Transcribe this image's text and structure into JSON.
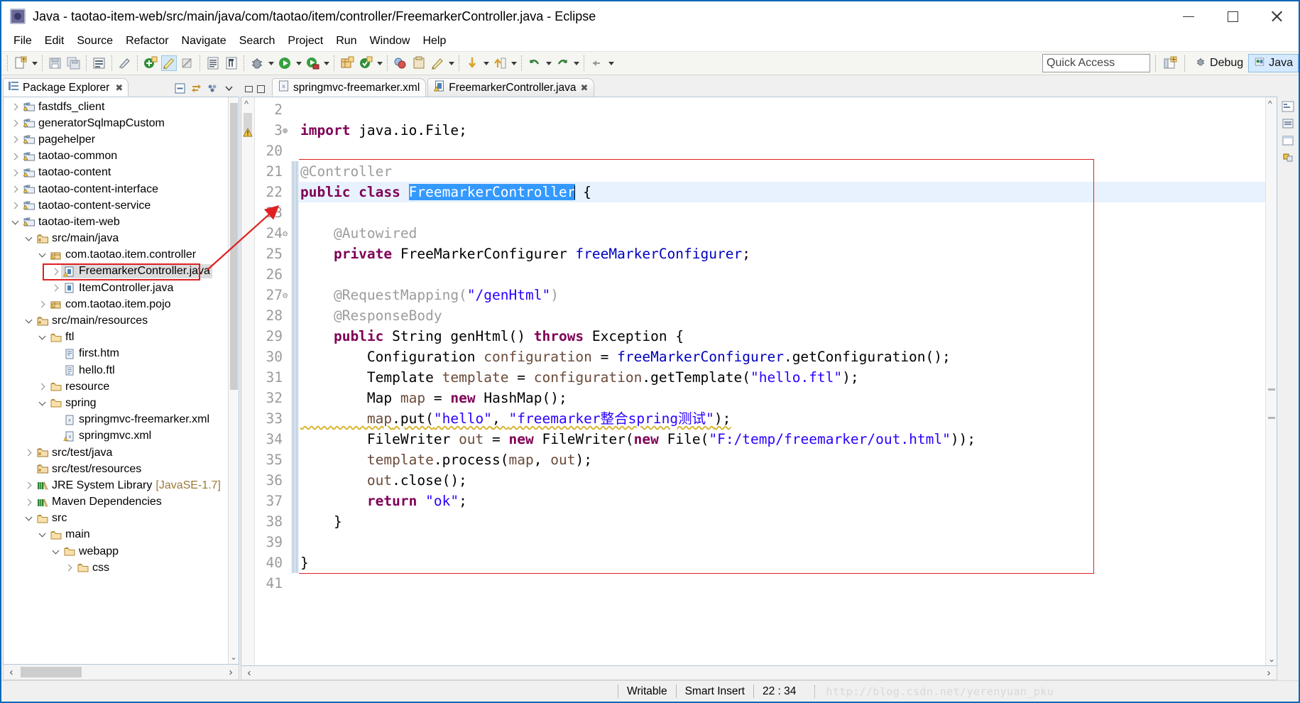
{
  "window": {
    "title": "Java - taotao-item-web/src/main/java/com/taotao/item/controller/FreemarkerController.java - Eclipse",
    "app_icon": "eclipse-icon",
    "minimize": "—",
    "maximize": "□",
    "close": "✕"
  },
  "menubar": {
    "items": [
      {
        "label": "File"
      },
      {
        "label": "Edit"
      },
      {
        "label": "Source"
      },
      {
        "label": "Refactor"
      },
      {
        "label": "Navigate"
      },
      {
        "label": "Search"
      },
      {
        "label": "Project"
      },
      {
        "label": "Run"
      },
      {
        "label": "Window"
      },
      {
        "label": "Help"
      }
    ]
  },
  "toolbar": {
    "quick_access_placeholder": "Quick Access",
    "quick_access_value": "Quick Access",
    "perspective_open_icon": "open-perspective-icon",
    "perspectives": [
      {
        "label": "Debug",
        "icon": "debug-perspective-icon",
        "active": false
      },
      {
        "label": "Java",
        "icon": "java-perspective-icon",
        "active": true
      }
    ]
  },
  "explorer": {
    "tab_label": "Package Explorer",
    "tab_close": "✖",
    "actions": [
      {
        "name": "collapse-all-icon"
      },
      {
        "name": "link-with-editor-icon"
      },
      {
        "name": "view-menu-icon"
      },
      {
        "name": "view-chevron-icon"
      }
    ],
    "tree": [
      {
        "label": "fastdfs_client",
        "indent": 0,
        "state": "collapsed",
        "icon": "maven-project-icon"
      },
      {
        "label": "generatorSqlmapCustom",
        "indent": 0,
        "state": "collapsed",
        "icon": "maven-project-icon"
      },
      {
        "label": "pagehelper",
        "indent": 0,
        "state": "collapsed",
        "icon": "maven-project-icon"
      },
      {
        "label": "taotao-common",
        "indent": 0,
        "state": "collapsed",
        "icon": "maven-project-icon"
      },
      {
        "label": "taotao-content",
        "indent": 0,
        "state": "collapsed",
        "icon": "maven-project-icon"
      },
      {
        "label": "taotao-content-interface",
        "indent": 0,
        "state": "collapsed",
        "icon": "maven-project-icon"
      },
      {
        "label": "taotao-content-service",
        "indent": 0,
        "state": "collapsed",
        "icon": "maven-project-icon"
      },
      {
        "label": "taotao-item-web",
        "indent": 0,
        "state": "expanded",
        "icon": "maven-project-icon"
      },
      {
        "label": "src/main/java",
        "indent": 1,
        "state": "expanded",
        "icon": "source-folder-icon"
      },
      {
        "label": "com.taotao.item.controller",
        "indent": 2,
        "state": "expanded",
        "icon": "package-icon"
      },
      {
        "label": "FreemarkerController.java",
        "indent": 3,
        "state": "collapsed",
        "icon": "java-file-warning-icon",
        "selected": true,
        "highlighted": true
      },
      {
        "label": "ItemController.java",
        "indent": 3,
        "state": "collapsed",
        "icon": "java-file-icon"
      },
      {
        "label": "com.taotao.item.pojo",
        "indent": 2,
        "state": "collapsed",
        "icon": "package-icon"
      },
      {
        "label": "src/main/resources",
        "indent": 1,
        "state": "expanded",
        "icon": "source-folder-icon"
      },
      {
        "label": "ftl",
        "indent": 2,
        "state": "expanded",
        "icon": "folder-icon"
      },
      {
        "label": "first.htm",
        "indent": 3,
        "state": "none",
        "icon": "html-file-icon"
      },
      {
        "label": "hello.ftl",
        "indent": 3,
        "state": "none",
        "icon": "file-icon"
      },
      {
        "label": "resource",
        "indent": 2,
        "state": "collapsed",
        "icon": "folder-icon"
      },
      {
        "label": "spring",
        "indent": 2,
        "state": "expanded",
        "icon": "folder-icon"
      },
      {
        "label": "springmvc-freemarker.xml",
        "indent": 3,
        "state": "none",
        "icon": "xml-file-icon"
      },
      {
        "label": "springmvc.xml",
        "indent": 3,
        "state": "none",
        "icon": "xml-file-warning-icon"
      },
      {
        "label": "src/test/java",
        "indent": 1,
        "state": "collapsed",
        "icon": "source-folder-icon"
      },
      {
        "label": "src/test/resources",
        "indent": 1,
        "state": "none",
        "icon": "source-folder-icon"
      },
      {
        "label": "JRE System Library",
        "indent": 1,
        "state": "collapsed",
        "icon": "library-icon",
        "suffix": "[JavaSE-1.7]"
      },
      {
        "label": "Maven Dependencies",
        "indent": 1,
        "state": "collapsed",
        "icon": "library-icon"
      },
      {
        "label": "src",
        "indent": 1,
        "state": "expanded",
        "icon": "folder-icon"
      },
      {
        "label": "main",
        "indent": 2,
        "state": "expanded",
        "icon": "folder-icon"
      },
      {
        "label": "webapp",
        "indent": 3,
        "state": "expanded",
        "icon": "folder-icon"
      },
      {
        "label": "css",
        "indent": 4,
        "state": "collapsed",
        "icon": "folder-icon"
      }
    ],
    "hscroll_left": "‹",
    "hscroll_right": "›",
    "vscroll_down": "⌄"
  },
  "editor": {
    "tabs": [
      {
        "label": "springmvc-freemarker.xml",
        "icon": "xml-file-icon",
        "active": false,
        "close": ""
      },
      {
        "label": "FreemarkerController.java",
        "icon": "java-file-warning-icon",
        "active": true,
        "close": "✖"
      }
    ],
    "minimize_tooltip": "Minimize",
    "maximize_tooltip": "Maximize",
    "status_cells": [
      {
        "name": "writable",
        "label": "Writable"
      },
      {
        "name": "insert-mode",
        "label": "Smart Insert"
      },
      {
        "name": "cursor-position",
        "label": "22 : 34"
      }
    ],
    "watermark": "http://blog.csdn.net/yerenyuan_pku",
    "scroll_left": "‹",
    "scroll_right": "›"
  },
  "code": {
    "lines": [
      {
        "num": "2",
        "fold": "",
        "tokens": []
      },
      {
        "num": "3",
        "fold": "⊕",
        "tokens": [
          {
            "t": "kw",
            "v": "import"
          },
          {
            "t": "pln",
            "v": " java.io.File;"
          }
        ]
      },
      {
        "num": "20",
        "fold": "",
        "tokens": []
      },
      {
        "num": "21",
        "fold": "",
        "tokens": [
          {
            "t": "ann",
            "v": "@Controller"
          }
        ]
      },
      {
        "num": "22",
        "fold": "",
        "hl": true,
        "tokens": [
          {
            "t": "kw",
            "v": "public class "
          },
          {
            "t": "sel",
            "v": "FreemarkerController"
          },
          {
            "t": "caret",
            "v": ""
          },
          {
            "t": "pln",
            "v": " {"
          }
        ]
      },
      {
        "num": "23",
        "fold": "",
        "tokens": []
      },
      {
        "num": "24",
        "fold": "⊝",
        "tokens": [
          {
            "t": "ann",
            "v": "    @Autowired"
          }
        ]
      },
      {
        "num": "25",
        "fold": "",
        "tokens": [
          {
            "t": "kw",
            "v": "    private"
          },
          {
            "t": "pln",
            "v": " FreeMarkerConfigurer "
          },
          {
            "t": "fld",
            "v": "freeMarkerConfigurer"
          },
          {
            "t": "pln",
            "v": ";"
          }
        ]
      },
      {
        "num": "26",
        "fold": "",
        "tokens": []
      },
      {
        "num": "27",
        "fold": "⊝",
        "tokens": [
          {
            "t": "ann",
            "v": "    @RequestMapping("
          },
          {
            "t": "str",
            "v": "\"/genHtml\""
          },
          {
            "t": "ann",
            "v": ")"
          }
        ]
      },
      {
        "num": "28",
        "fold": "",
        "tokens": [
          {
            "t": "ann",
            "v": "    @ResponseBody"
          }
        ]
      },
      {
        "num": "29",
        "fold": "",
        "tokens": [
          {
            "t": "kw",
            "v": "    public"
          },
          {
            "t": "pln",
            "v": " String genHtml() "
          },
          {
            "t": "kw",
            "v": "throws"
          },
          {
            "t": "pln",
            "v": " Exception {"
          }
        ]
      },
      {
        "num": "30",
        "fold": "",
        "tokens": [
          {
            "t": "pln",
            "v": "        Configuration "
          },
          {
            "t": "loc",
            "v": "configuration"
          },
          {
            "t": "pln",
            "v": " = "
          },
          {
            "t": "fld",
            "v": "freeMarkerConfigurer"
          },
          {
            "t": "pln",
            "v": ".getConfiguration();"
          }
        ]
      },
      {
        "num": "31",
        "fold": "",
        "tokens": [
          {
            "t": "pln",
            "v": "        Template "
          },
          {
            "t": "loc",
            "v": "template"
          },
          {
            "t": "pln",
            "v": " = "
          },
          {
            "t": "loc",
            "v": "configuration"
          },
          {
            "t": "pln",
            "v": ".getTemplate("
          },
          {
            "t": "str",
            "v": "\"hello.ftl\""
          },
          {
            "t": "pln",
            "v": ");"
          }
        ]
      },
      {
        "num": "32",
        "fold": "",
        "tokens": [
          {
            "t": "pln",
            "v": "        Map "
          },
          {
            "t": "loc",
            "v": "map"
          },
          {
            "t": "pln",
            "v": " = "
          },
          {
            "t": "kw",
            "v": "new"
          },
          {
            "t": "pln",
            "v": " HashMap();"
          }
        ]
      },
      {
        "num": "33",
        "fold": "",
        "wavy": true,
        "tokens": [
          {
            "t": "loc",
            "v": "        map"
          },
          {
            "t": "pln",
            "v": ".put("
          },
          {
            "t": "str",
            "v": "\"hello\""
          },
          {
            "t": "pln",
            "v": ", "
          },
          {
            "t": "str",
            "v": "\"freemarker整合spring测试\""
          },
          {
            "t": "pln",
            "v": ");"
          }
        ]
      },
      {
        "num": "34",
        "fold": "",
        "tokens": [
          {
            "t": "pln",
            "v": "        FileWriter "
          },
          {
            "t": "loc",
            "v": "out"
          },
          {
            "t": "pln",
            "v": " = "
          },
          {
            "t": "kw",
            "v": "new"
          },
          {
            "t": "pln",
            "v": " FileWriter("
          },
          {
            "t": "kw",
            "v": "new"
          },
          {
            "t": "pln",
            "v": " File("
          },
          {
            "t": "str",
            "v": "\"F:/temp/freemarker/out.html\""
          },
          {
            "t": "pln",
            "v": "));"
          }
        ]
      },
      {
        "num": "35",
        "fold": "",
        "tokens": [
          {
            "t": "loc",
            "v": "        template"
          },
          {
            "t": "pln",
            "v": ".process("
          },
          {
            "t": "loc",
            "v": "map"
          },
          {
            "t": "pln",
            "v": ", "
          },
          {
            "t": "loc",
            "v": "out"
          },
          {
            "t": "pln",
            "v": ");"
          }
        ]
      },
      {
        "num": "36",
        "fold": "",
        "tokens": [
          {
            "t": "loc",
            "v": "        out"
          },
          {
            "t": "pln",
            "v": ".close();"
          }
        ]
      },
      {
        "num": "37",
        "fold": "",
        "tokens": [
          {
            "t": "kw",
            "v": "        return"
          },
          {
            "t": "pln",
            "v": " "
          },
          {
            "t": "str",
            "v": "\"ok\""
          },
          {
            "t": "pln",
            "v": ";"
          }
        ]
      },
      {
        "num": "38",
        "fold": "",
        "tokens": [
          {
            "t": "pln",
            "v": "    }"
          }
        ]
      },
      {
        "num": "39",
        "fold": "",
        "tokens": []
      },
      {
        "num": "40",
        "fold": "",
        "tokens": [
          {
            "t": "pln",
            "v": "}"
          }
        ]
      },
      {
        "num": "41",
        "fold": "",
        "tokens": []
      }
    ]
  },
  "annotations": {
    "accent_red": "#e02020",
    "selection_blue": "#3399ff",
    "highlight_line": "#e8f2fe"
  }
}
